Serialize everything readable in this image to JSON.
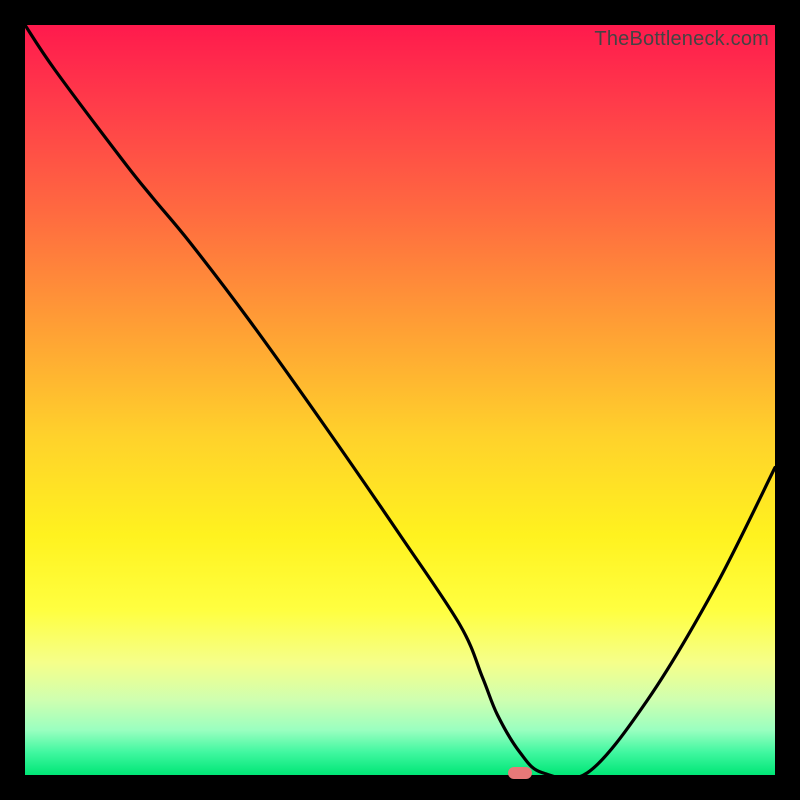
{
  "watermark": "TheBottleneck.com",
  "colors": {
    "background": "#000000",
    "gradient_top": "#ff1a4d",
    "gradient_bottom": "#00e676",
    "curve": "#000000",
    "marker": "#e87878"
  },
  "chart_data": {
    "type": "line",
    "title": "",
    "xlabel": "",
    "ylabel": "",
    "xlim": [
      0,
      100
    ],
    "ylim": [
      0,
      100
    ],
    "series": [
      {
        "name": "bottleneck-curve",
        "x": [
          0,
          4,
          13,
          17,
          22,
          30,
          40,
          50,
          58,
          61,
          63,
          66,
          69,
          75,
          83,
          92,
          100
        ],
        "values": [
          100,
          94,
          82,
          77,
          71,
          60.5,
          46.5,
          32,
          20,
          13,
          8,
          3,
          0.3,
          0.3,
          10,
          25,
          41
        ]
      }
    ],
    "marker": {
      "x": 66,
      "y": 0.3
    },
    "annotations": []
  }
}
